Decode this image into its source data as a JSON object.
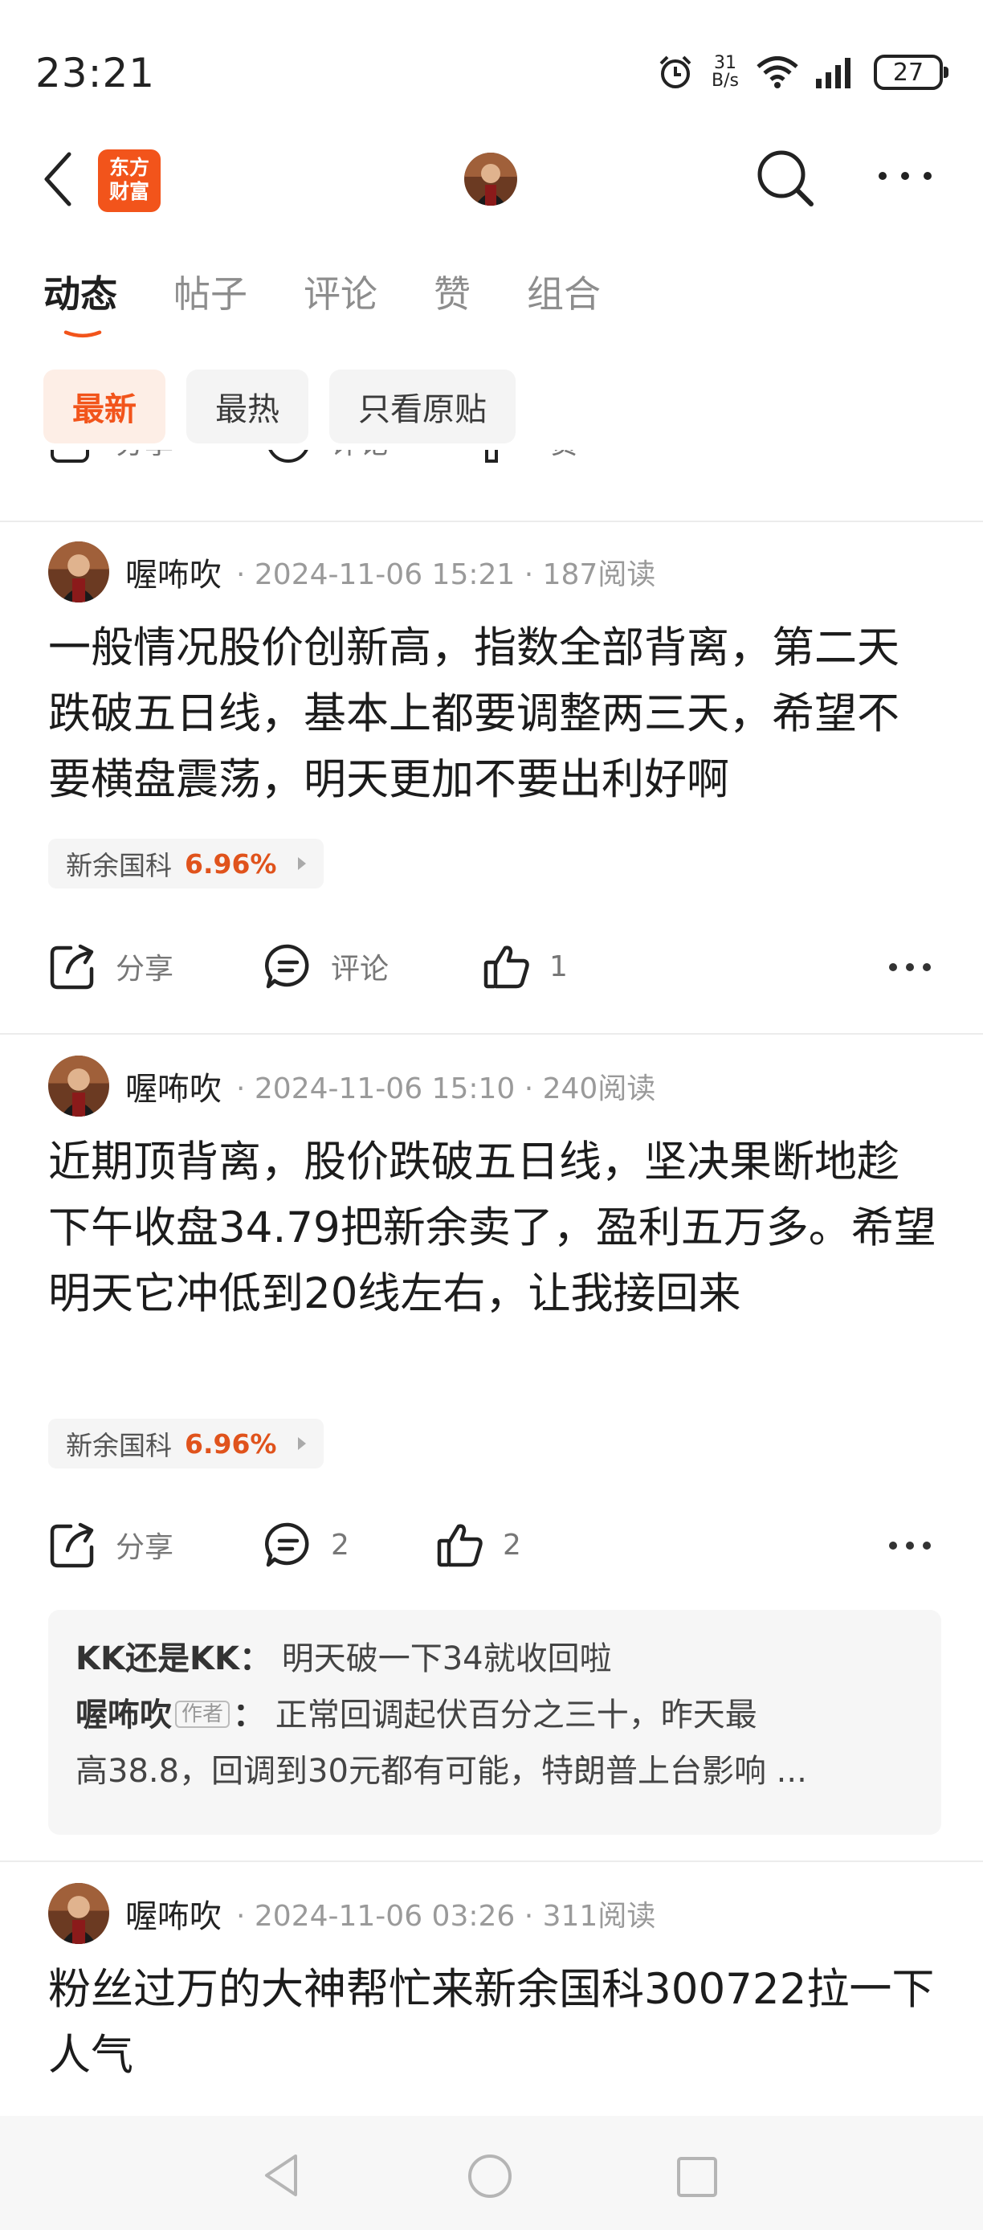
{
  "status": {
    "time": "23:21",
    "net_speed_value": "31",
    "net_speed_unit": "B/s",
    "battery": "27"
  },
  "header": {
    "brand_line1": "东方",
    "brand_line2": "财富"
  },
  "tabs": [
    {
      "label": "动态",
      "active": true
    },
    {
      "label": "帖子",
      "active": false
    },
    {
      "label": "评论",
      "active": false
    },
    {
      "label": "赞",
      "active": false
    },
    {
      "label": "组合",
      "active": false
    }
  ],
  "filters": [
    {
      "label": "最新",
      "active": true
    },
    {
      "label": "最热",
      "active": false
    },
    {
      "label": "只看原贴",
      "active": false
    }
  ],
  "colors": {
    "accent": "#f2541b",
    "stock_up": "#e0531c"
  },
  "posts": [
    {
      "author": "喔咘吹",
      "meta": "· 2024-11-06 15:21 · 187阅读",
      "content": "一般情况股价创新高，指数全部背离，第二天跌破五日线，基本上都要调整两三天，希望不要横盘震荡，明天更加不要出利好啊",
      "stock_name": "新余国科",
      "stock_change": "6.96%",
      "share_label": "分享",
      "comment_label": "评论",
      "like_count": "1"
    },
    {
      "author": "喔咘吹",
      "meta": "· 2024-11-06 15:10 · 240阅读",
      "content": "近期顶背离，股价跌破五日线，坚决果断地趁下午收盘34.79把新余卖了，盈利五万多。希望明天它冲低到20线左右，让我接回来",
      "stock_name": "新余国科",
      "stock_change": "6.96%",
      "share_label": "分享",
      "comment_label": "2",
      "like_count": "2",
      "comments": [
        {
          "name": "KK还是KK",
          "sep": "：",
          "text": "明天破一下34就收回啦"
        },
        {
          "name": "喔咘吹",
          "tag": "作者",
          "sep": "：",
          "text": "正常回调起伏百分之三十，昨天最"
        },
        {
          "text": "高38.8，回调到30元都有可能，特朗普上台影响 ..."
        }
      ]
    },
    {
      "author": "喔咘吹",
      "meta": "· 2024-11-06 03:26 · 311阅读",
      "content": "粉丝过万的大神帮忙来新余国科300722拉一下人气"
    }
  ],
  "partial_prev_actions": {
    "share_label": "分享",
    "comment_label": "评论",
    "like_label": "赞"
  }
}
